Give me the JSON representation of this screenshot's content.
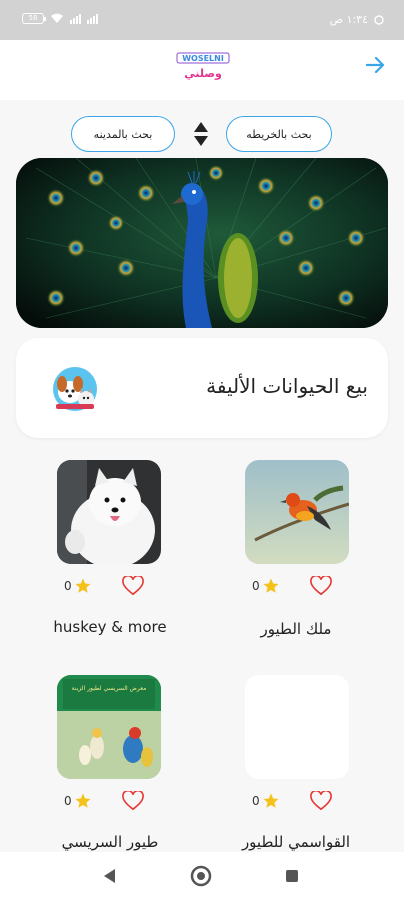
{
  "status_bar": {
    "battery": "58",
    "time": "١:٣٤ ص"
  },
  "header": {
    "logo_text_top": "WOSELNI",
    "logo_text_bottom": "وصلني"
  },
  "search": {
    "by_map_label": "بحث بالخريطه",
    "by_city_label": "بحث بالمدينه"
  },
  "category": {
    "title": "بيع الحيوانات الأليفة"
  },
  "stores": [
    {
      "name": "ملك الطيور",
      "rating": "0"
    },
    {
      "name": "huskey & more",
      "rating": "0"
    },
    {
      "name": "القواسمي للطيور",
      "rating": "0"
    },
    {
      "name": "طيور السريسي",
      "rating": "0"
    }
  ],
  "store_photo_text": "معرض السريسي لطيور الزينة",
  "colors": {
    "accent": "#3aa6e8",
    "heart": "#e53935",
    "star": "#f4c21b",
    "status_bar": "#d2d2d2"
  }
}
